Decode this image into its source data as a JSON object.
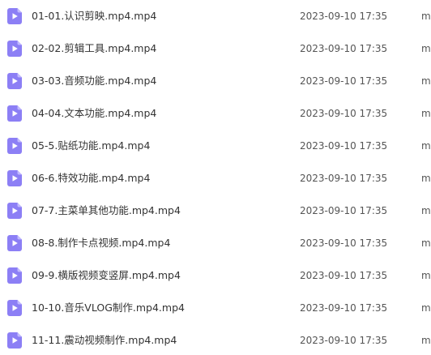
{
  "colors": {
    "icon_fill": "#8c7ff5",
    "icon_fold": "#c2baff",
    "icon_play": "#ffffff",
    "text": "#333333",
    "meta_text": "#555555"
  },
  "files": [
    {
      "name": "01-01.认识剪映.mp4.mp4",
      "modified": "2023-09-10 17:35",
      "size_partial": "m",
      "icon": "video-file-icon"
    },
    {
      "name": "02-02.剪辑工具.mp4.mp4",
      "modified": "2023-09-10 17:35",
      "size_partial": "m",
      "icon": "video-file-icon"
    },
    {
      "name": "03-03.音频功能.mp4.mp4",
      "modified": "2023-09-10 17:35",
      "size_partial": "m",
      "icon": "video-file-icon"
    },
    {
      "name": "04-04.文本功能.mp4.mp4",
      "modified": "2023-09-10 17:35",
      "size_partial": "m",
      "icon": "video-file-icon"
    },
    {
      "name": "05-5.贴纸功能.mp4.mp4",
      "modified": "2023-09-10 17:35",
      "size_partial": "m",
      "icon": "video-file-icon"
    },
    {
      "name": "06-6.特效功能.mp4.mp4",
      "modified": "2023-09-10 17:35",
      "size_partial": "m",
      "icon": "video-file-icon"
    },
    {
      "name": "07-7.主菜单其他功能.mp4.mp4",
      "modified": "2023-09-10 17:35",
      "size_partial": "m",
      "icon": "video-file-icon"
    },
    {
      "name": "08-8.制作卡点视频.mp4.mp4",
      "modified": "2023-09-10 17:35",
      "size_partial": "m",
      "icon": "video-file-icon"
    },
    {
      "name": "09-9.横版视频变竖屏.mp4.mp4",
      "modified": "2023-09-10 17:35",
      "size_partial": "m",
      "icon": "video-file-icon"
    },
    {
      "name": "10-10.音乐VLOG制作.mp4.mp4",
      "modified": "2023-09-10 17:35",
      "size_partial": "m",
      "icon": "video-file-icon"
    },
    {
      "name": "11-11.震动视频制作.mp4.mp4",
      "modified": "2023-09-10 17:35",
      "size_partial": "m",
      "icon": "video-file-icon"
    }
  ]
}
